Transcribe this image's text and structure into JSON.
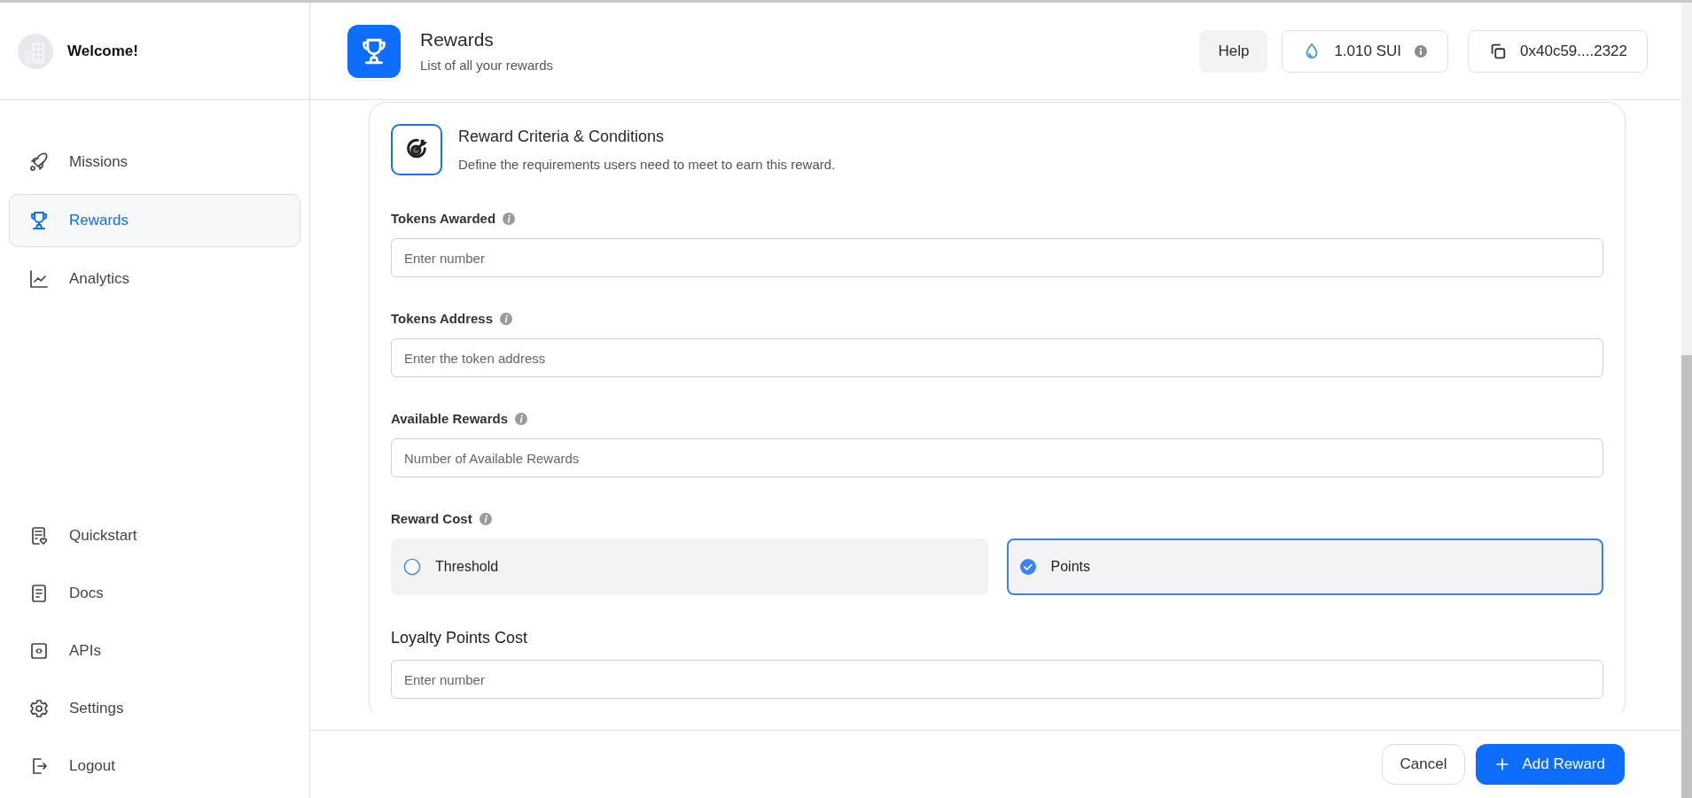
{
  "sidebar": {
    "welcome": "Welcome!",
    "nav_items": [
      {
        "label": "Missions",
        "kind": "rocket",
        "selected": false
      },
      {
        "label": "Rewards",
        "kind": "trophy",
        "selected": true
      },
      {
        "label": "Analytics",
        "kind": "chart",
        "selected": false
      }
    ],
    "bottom_items": [
      {
        "label": "Quickstart",
        "kind": "checklist"
      },
      {
        "label": "Docs",
        "kind": "document"
      },
      {
        "label": "APIs",
        "kind": "code"
      },
      {
        "label": "Settings",
        "kind": "gear"
      },
      {
        "label": "Logout",
        "kind": "exit"
      }
    ]
  },
  "header": {
    "title": "Rewards",
    "subtitle": "List of all your rewards",
    "help": "Help",
    "balance": "1.010 SUI",
    "address": "0x40c59....2322"
  },
  "card": {
    "title": "Reward Criteria & Conditions",
    "description": "Define the requirements users need to meet to earn this reward.",
    "fields": [
      {
        "kind": "input",
        "label": "Tokens Awarded",
        "info": true,
        "placeholder": "Enter number"
      },
      {
        "kind": "input",
        "label": "Tokens Address",
        "info": true,
        "placeholder": "Enter the token address"
      },
      {
        "kind": "input",
        "label": "Available Rewards",
        "info": true,
        "placeholder": "Number of Available Rewards"
      },
      {
        "kind": "choice",
        "label": "Reward Cost",
        "info": true,
        "options": [
          {
            "label": "Threshold",
            "selected": false
          },
          {
            "label": "Points",
            "selected": true
          }
        ]
      },
      {
        "kind": "input",
        "label": "Loyalty Points Cost",
        "info": false,
        "placeholder": "Enter number"
      }
    ]
  },
  "footer": {
    "cancel": "Cancel",
    "submit": "Add Reward"
  }
}
